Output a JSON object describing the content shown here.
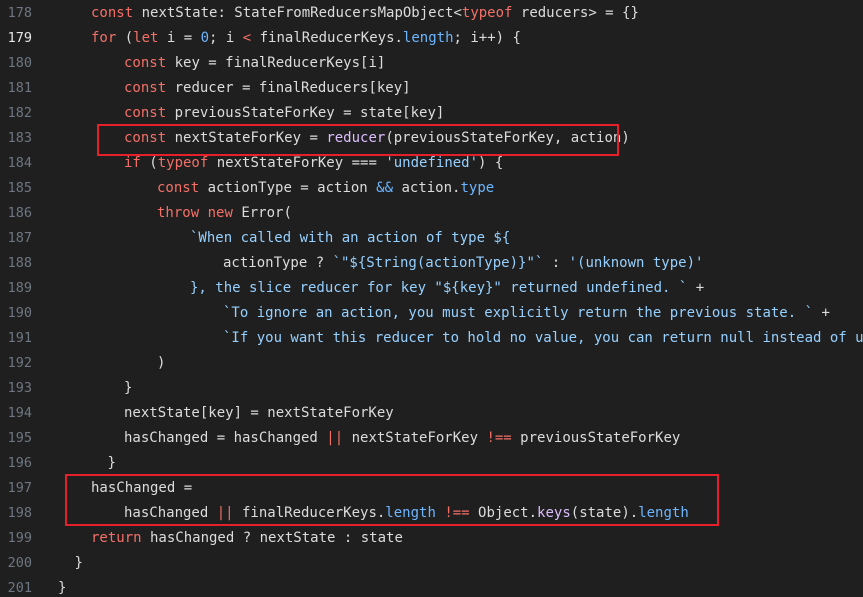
{
  "editor": {
    "active_line": "179",
    "lines": [
      {
        "num": "178",
        "indent": 1,
        "tokens": [
          {
            "c": "kw",
            "t": "const"
          },
          {
            "c": "plain",
            "t": " nextState: StateFromReducersMapObject<"
          },
          {
            "c": "kw",
            "t": "typeof"
          },
          {
            "c": "plain",
            "t": " reducers> = {}"
          }
        ]
      },
      {
        "num": "179",
        "indent": 1,
        "tokens": [
          {
            "c": "kw",
            "t": "for"
          },
          {
            "c": "plain",
            "t": " ("
          },
          {
            "c": "kw",
            "t": "let"
          },
          {
            "c": "plain",
            "t": " i = "
          },
          {
            "c": "prop",
            "t": "0"
          },
          {
            "c": "plain",
            "t": "; i "
          },
          {
            "c": "kw",
            "t": "<"
          },
          {
            "c": "plain",
            "t": " finalReducerKeys."
          },
          {
            "c": "prop",
            "t": "length"
          },
          {
            "c": "plain",
            "t": "; i++) {"
          }
        ]
      },
      {
        "num": "180",
        "indent": 2,
        "tokens": [
          {
            "c": "kw",
            "t": "const"
          },
          {
            "c": "plain",
            "t": " key = finalReducerKeys[i]"
          }
        ]
      },
      {
        "num": "181",
        "indent": 2,
        "tokens": [
          {
            "c": "kw",
            "t": "const"
          },
          {
            "c": "plain",
            "t": " reducer = finalReducers[key]"
          }
        ]
      },
      {
        "num": "182",
        "indent": 2,
        "tokens": [
          {
            "c": "kw",
            "t": "const"
          },
          {
            "c": "plain",
            "t": " previousStateForKey = state[key]"
          }
        ]
      },
      {
        "num": "183",
        "indent": 2,
        "tokens": [
          {
            "c": "kw",
            "t": "const"
          },
          {
            "c": "plain",
            "t": " nextStateForKey = "
          },
          {
            "c": "fn",
            "t": "reducer"
          },
          {
            "c": "plain",
            "t": "(previousStateForKey, action)"
          }
        ]
      },
      {
        "num": "184",
        "indent": 2,
        "tokens": [
          {
            "c": "kw",
            "t": "if"
          },
          {
            "c": "plain",
            "t": " ("
          },
          {
            "c": "kw",
            "t": "typeof"
          },
          {
            "c": "plain",
            "t": " nextStateForKey === "
          },
          {
            "c": "str",
            "t": "'undefined'"
          },
          {
            "c": "plain",
            "t": ") {"
          }
        ]
      },
      {
        "num": "185",
        "indent": 3,
        "tokens": [
          {
            "c": "kw",
            "t": "const"
          },
          {
            "c": "plain",
            "t": " actionType = action "
          },
          {
            "c": "prop",
            "t": "&&"
          },
          {
            "c": "plain",
            "t": " action."
          },
          {
            "c": "prop",
            "t": "type"
          }
        ]
      },
      {
        "num": "186",
        "indent": 3,
        "tokens": [
          {
            "c": "kw",
            "t": "throw"
          },
          {
            "c": "plain",
            "t": " "
          },
          {
            "c": "kw",
            "t": "new"
          },
          {
            "c": "plain",
            "t": " Error("
          }
        ]
      },
      {
        "num": "187",
        "indent": 4,
        "tokens": [
          {
            "c": "str",
            "t": "`When called with an action of type ${"
          }
        ]
      },
      {
        "num": "188",
        "indent": 5,
        "tokens": [
          {
            "c": "plain",
            "t": "actionType ? "
          },
          {
            "c": "str",
            "t": "`\"${String(actionType)}\"`"
          },
          {
            "c": "plain",
            "t": " : "
          },
          {
            "c": "str",
            "t": "'(unknown type)'"
          }
        ]
      },
      {
        "num": "189",
        "indent": 4,
        "tokens": [
          {
            "c": "str",
            "t": "}, the slice reducer for key \"${key}\" returned undefined. `"
          },
          {
            "c": "plain",
            "t": " +"
          }
        ]
      },
      {
        "num": "190",
        "indent": 5,
        "tokens": [
          {
            "c": "str",
            "t": "`To ignore an action, you must explicitly return the previous state. `"
          },
          {
            "c": "plain",
            "t": " +"
          }
        ]
      },
      {
        "num": "191",
        "indent": 5,
        "tokens": [
          {
            "c": "str",
            "t": "`If you want this reducer to hold no value, you can return null instead of undefined.`"
          }
        ]
      },
      {
        "num": "192",
        "indent": 3,
        "tokens": [
          {
            "c": "plain",
            "t": ")"
          }
        ]
      },
      {
        "num": "193",
        "indent": 2,
        "tokens": [
          {
            "c": "plain",
            "t": "}"
          }
        ]
      },
      {
        "num": "194",
        "indent": 2,
        "tokens": [
          {
            "c": "plain",
            "t": "nextState[key] = nextStateForKey"
          }
        ]
      },
      {
        "num": "195",
        "indent": 2,
        "tokens": [
          {
            "c": "plain",
            "t": "hasChanged = hasChanged "
          },
          {
            "c": "kw",
            "t": "||"
          },
          {
            "c": "plain",
            "t": " nextStateForKey "
          },
          {
            "c": "kw",
            "t": "!=="
          },
          {
            "c": "plain",
            "t": " previousStateForKey"
          }
        ]
      },
      {
        "num": "196",
        "indent": 1.5,
        "tokens": [
          {
            "c": "plain",
            "t": "}"
          }
        ]
      },
      {
        "num": "197",
        "indent": 1,
        "tokens": [
          {
            "c": "plain",
            "t": "hasChanged ="
          }
        ]
      },
      {
        "num": "198",
        "indent": 2,
        "tokens": [
          {
            "c": "plain",
            "t": "hasChanged "
          },
          {
            "c": "kw",
            "t": "||"
          },
          {
            "c": "plain",
            "t": " finalReducerKeys."
          },
          {
            "c": "prop",
            "t": "length"
          },
          {
            "c": "plain",
            "t": " "
          },
          {
            "c": "kw",
            "t": "!=="
          },
          {
            "c": "plain",
            "t": " Object."
          },
          {
            "c": "fn",
            "t": "keys"
          },
          {
            "c": "plain",
            "t": "(state)."
          },
          {
            "c": "prop",
            "t": "length"
          }
        ]
      },
      {
        "num": "199",
        "indent": 1,
        "tokens": [
          {
            "c": "kw",
            "t": "return"
          },
          {
            "c": "plain",
            "t": " hasChanged ? nextState : state"
          }
        ]
      },
      {
        "num": "200",
        "indent": 0.5,
        "tokens": [
          {
            "c": "plain",
            "t": "}"
          }
        ]
      },
      {
        "num": "201",
        "indent": 0,
        "tokens": [
          {
            "c": "plain",
            "t": "}"
          }
        ]
      }
    ]
  },
  "colors": {
    "background": "#1f1f1f",
    "keyword": "#f47067",
    "string": "#96d0ff",
    "function": "#dcbdfb",
    "property": "#6cb6ff",
    "line_number": "#6e7681",
    "highlight_border": "#e5202a"
  }
}
